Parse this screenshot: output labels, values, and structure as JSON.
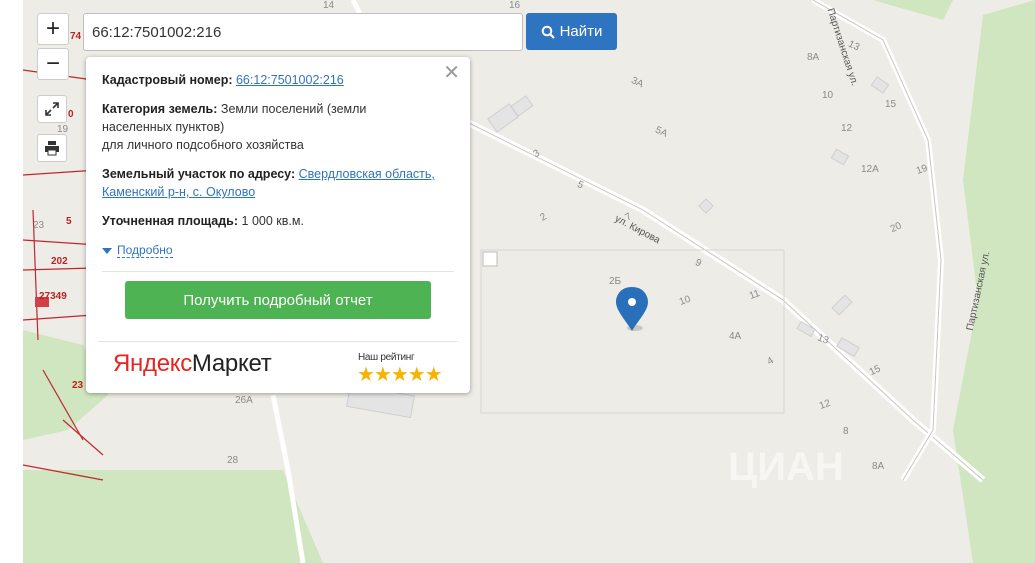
{
  "search": {
    "value": "66:12:7501002:216",
    "button_label": "Найти",
    "button_icon": "search-icon"
  },
  "controls": {
    "zoom_in": "+",
    "zoom_out": "−",
    "fullscreen_icon": "expand-icon",
    "print_icon": "printer-icon"
  },
  "popup": {
    "cadastral_label": "Кадастровый номер:",
    "cadastral_value": "66:12:7501002:216",
    "category_label": "Категория земель:",
    "category_value_line1": "Земли поселений (земли",
    "category_value_line2": "населенных пунктов)",
    "category_value_line3": "для личного подсобного хозяйства",
    "address_label": "Земельный участок по адресу:",
    "address_value_line1": "Свердловская область,",
    "address_value_line2": "Каменский р-н, с. Окулово",
    "area_label": "Уточненная площадь:",
    "area_value": "1 000 кв.м.",
    "more_label": "Подробно",
    "report_button": "Получить подробный отчет",
    "market_logo_part1": "Яндекс",
    "market_logo_part2": "Маркет",
    "rating_label": "Наш рейтинг",
    "rating_stars": "★★★★★",
    "rating_value": 5
  },
  "map": {
    "streets": [
      "ул. Кирова",
      "Партизанская ул."
    ],
    "top_street": "Партизанская ул.",
    "house_numbers": [
      "14",
      "16",
      "3А",
      "5А",
      "3",
      "5",
      "2",
      "7",
      "9",
      "2Б",
      "10",
      "11",
      "4А",
      "4",
      "13",
      "15",
      "12",
      "8",
      "8А",
      "8А",
      "10",
      "12",
      "12А",
      "19",
      "20",
      "13",
      "15",
      "26А",
      "28"
    ],
    "cadastral_labels": [
      "74",
      "0",
      "19",
      "23",
      "5",
      "202",
      "27349",
      "23"
    ],
    "watermark": "ЦИАН",
    "marker_icon": "map-pin-icon",
    "colors": {
      "background": "#eeece6",
      "green": "#cfe6c0",
      "road": "#ffffff",
      "cadastral": "#c0272d",
      "marker": "#2a6fba"
    }
  }
}
